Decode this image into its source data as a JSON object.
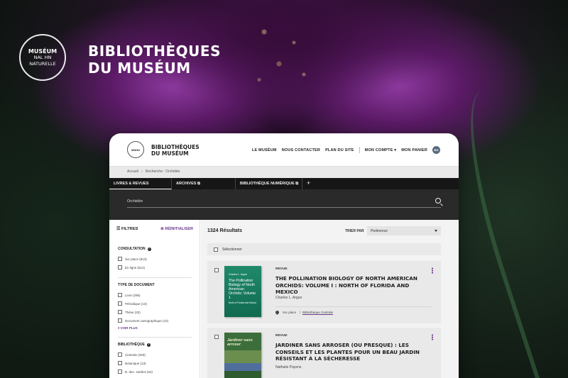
{
  "brand": {
    "logo_lines": [
      "MUSÉUM",
      "NAL HN",
      "NATURELLE"
    ],
    "title_line1": "BIBLIOTHÈQUES",
    "title_line2": "DU MUSÉUM"
  },
  "site": {
    "header": {
      "title_line1": "BIBLIOTHÈQUES",
      "title_line2": "DU MUSÉUM",
      "nav": [
        "LE MUSÉUM",
        "NOUS CONTACTER",
        "PLAN DU SITE"
      ],
      "account": "MON COMPTE",
      "cart": "MON PANIER",
      "avatar_initials": "BN"
    },
    "breadcrumb": [
      "Accueil",
      "Recherche : Orchidée"
    ],
    "tabs": [
      "LIVRES & REVUES",
      "ARCHIVES",
      "BIBLIOTHÈQUE NUMÉRIQUE"
    ],
    "tab_add_label": "+",
    "search": {
      "value": "Orchidée"
    },
    "filters": {
      "title": "FILTRES",
      "reset": "RÉINITIALISER",
      "sections": [
        {
          "title": "CONSULTATION",
          "options": [
            "Sur place (813)",
            "En ligne (512)"
          ]
        },
        {
          "title": "TYPE DE DOCUMENT",
          "options": [
            "Livre (296)",
            "Périodique (13)",
            "Thèse (32)",
            "Document cartographique (10)"
          ],
          "more": "VOIR PLUS"
        },
        {
          "title": "BIBLIOTHÈQUE",
          "options": [
            "Centrale (293)",
            "Botanique (13)",
            "B. des. Jardins (52)"
          ]
        }
      ]
    },
    "results": {
      "count_label": "1324 Résultats",
      "sort_label": "TRIER PAR",
      "sort_value": "Pertinence",
      "select_all": "Sélectionner",
      "items": [
        {
          "type": "REVUE",
          "title": "THE POLLINATION BIOLOGY OF NORTH AMERICAN ORCHIDS: VOLUME I : NORTH OF FLORIDA AND MEXICO",
          "author": "Charles L. Argue",
          "location": "Sur place",
          "library": "Bibliothèque Centrale",
          "cover_author": "Charles L. Argue",
          "cover_title": "The Pollination Biology of North American Orchids: Volume 1",
          "cover_sub": "North of Florida and Mexico",
          "cover_publisher": "Springer"
        },
        {
          "type": "REVUE",
          "title": "JARDINER SANS ARROSER (OU PRESQUE) : LES CONSEILS ET LES PLANTES POUR UN BEAU JARDIN RÉSISTANT À LA SÉCHERESSE",
          "author": "Nathalie Payens",
          "cover_title": "Jardiner sans arroser"
        }
      ]
    }
  },
  "colors": {
    "accent": "#6d3b8e",
    "dark_bar": "#2a2a2a"
  }
}
